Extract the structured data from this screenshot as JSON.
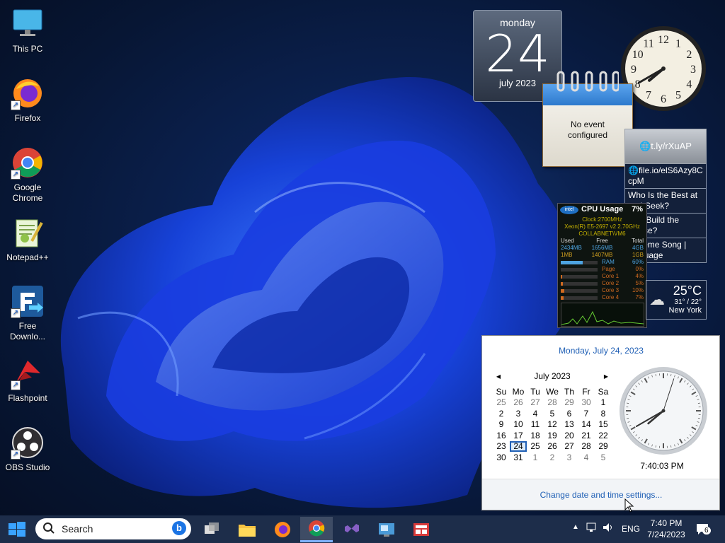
{
  "desktop": {
    "icons": [
      {
        "label": "This PC",
        "icon": "monitor-icon"
      },
      {
        "label": "Firefox",
        "icon": "firefox-icon"
      },
      {
        "label": "Google Chrome",
        "icon": "chrome-icon"
      },
      {
        "label": "Notepad++",
        "icon": "notepadpp-icon"
      },
      {
        "label": "Free Downlo...",
        "icon": "free-download-manager-icon"
      },
      {
        "label": "Flashpoint",
        "icon": "flashpoint-icon"
      },
      {
        "label": "OBS Studio",
        "icon": "obs-icon"
      }
    ]
  },
  "gadgets": {
    "calendar": {
      "weekday": "monday",
      "day": "24",
      "month_year": "july 2023"
    },
    "notepad": {
      "line1": "No event",
      "line2": "configured"
    },
    "analog_clock": {
      "hour": 7,
      "minute": 40,
      "second": 3
    },
    "rss": {
      "items": [
        "t.ly/rXuAP",
        "file.io/elS6Azy8C cpM",
        "Who Is the Best at and-Seek?",
        "Can Build the House?",
        "r Theme Song | language"
      ]
    },
    "cpu": {
      "title": "CPU Usage",
      "percent": "7%",
      "clock": "Clock:2700MHz",
      "processor": "Xeon(R) E5-2697 v2 2.70GHz",
      "machine": "COLLABNET\\VM6",
      "headers": [
        "Used",
        "Free",
        "Total"
      ],
      "mem_row": [
        "2434MB",
        "1656MB",
        "4GB"
      ],
      "page_row": [
        "1MB",
        "1407MB",
        "1GB"
      ],
      "bars": [
        {
          "label": "RAM",
          "value": "60%",
          "fraction": 0.6,
          "color": "#4da3e0"
        },
        {
          "label": "Page",
          "value": "0%",
          "fraction": 0.0,
          "color": "#d06a20"
        },
        {
          "label": "Core 1",
          "value": "4%",
          "fraction": 0.04,
          "color": "#d06a20"
        },
        {
          "label": "Core 2",
          "value": "5%",
          "fraction": 0.05,
          "color": "#d06a20"
        },
        {
          "label": "Core 3",
          "value": "10%",
          "fraction": 0.1,
          "color": "#d06a20"
        },
        {
          "label": "Core 4",
          "value": "7%",
          "fraction": 0.07,
          "color": "#d06a20"
        }
      ]
    },
    "weather": {
      "temp": "25°C",
      "range": "31° / 22°",
      "city": "New York"
    }
  },
  "flyout": {
    "date_long": "Monday, July 24, 2023",
    "month_label": "July 2023",
    "weekdays": [
      "Su",
      "Mo",
      "Tu",
      "We",
      "Th",
      "Fr",
      "Sa"
    ],
    "weeks": [
      [
        "25",
        "26",
        "27",
        "28",
        "29",
        "30",
        "1"
      ],
      [
        "2",
        "3",
        "4",
        "5",
        "6",
        "7",
        "8"
      ],
      [
        "9",
        "10",
        "11",
        "12",
        "13",
        "14",
        "15"
      ],
      [
        "16",
        "17",
        "18",
        "19",
        "20",
        "21",
        "22"
      ],
      [
        "23",
        "24",
        "25",
        "26",
        "27",
        "28",
        "29"
      ],
      [
        "30",
        "31",
        "1",
        "2",
        "3",
        "4",
        "5"
      ]
    ],
    "today": "24",
    "time": "7:40:03 PM",
    "link": "Change date and time settings..."
  },
  "taskbar": {
    "search_label": "Search",
    "apps": [
      "task-view-icon",
      "file-explorer-icon",
      "firefox-icon",
      "chrome-icon",
      "visual-studio-icon",
      "control-panel-icon",
      "news-app-icon"
    ],
    "language": "ENG",
    "clock_time": "7:40 PM",
    "clock_date": "7/24/2023",
    "notifications": "6"
  }
}
